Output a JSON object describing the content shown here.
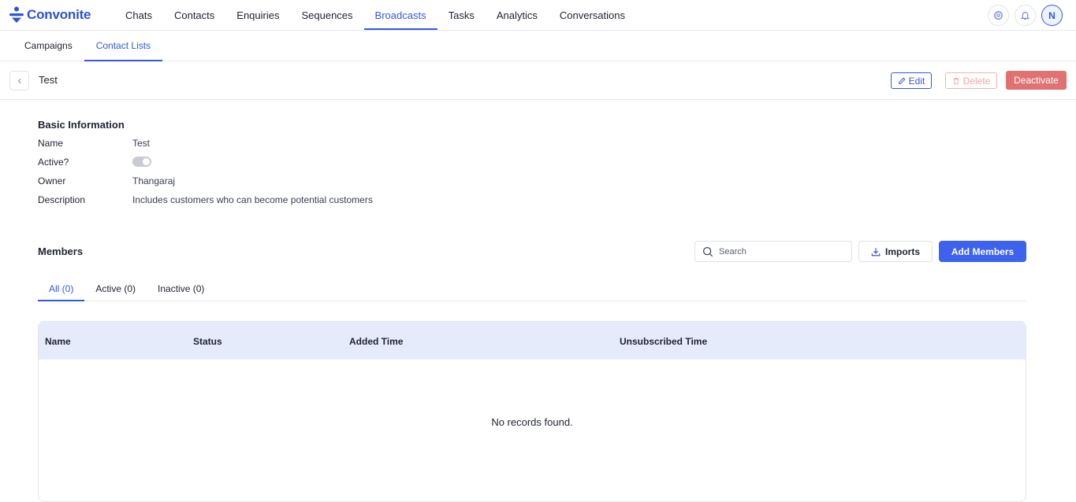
{
  "brand": {
    "name": "Convonite",
    "color": "#2c52d6"
  },
  "nav": {
    "items": [
      {
        "label": "Chats"
      },
      {
        "label": "Contacts"
      },
      {
        "label": "Enquiries"
      },
      {
        "label": "Sequences"
      },
      {
        "label": "Broadcasts",
        "active": true
      },
      {
        "label": "Tasks"
      },
      {
        "label": "Analytics"
      },
      {
        "label": "Conversations"
      }
    ],
    "icons": [
      "gear-icon",
      "bell-icon"
    ],
    "avatar_initial": "N"
  },
  "subtabs": [
    {
      "label": "Campaigns"
    },
    {
      "label": "Contact Lists",
      "active": true
    }
  ],
  "header": {
    "title": "Test",
    "edit_label": "Edit",
    "delete_label": "Delete",
    "deactivate_label": "Deactivate"
  },
  "basic_info": {
    "title": "Basic Information",
    "name_label": "Name",
    "name_value": "Test",
    "active_label": "Active?",
    "active_value": false,
    "owner_label": "Owner",
    "owner_value": "Thangaraj",
    "description_label": "Description",
    "description_value": "Includes customers who can become potential customers"
  },
  "members": {
    "title": "Members",
    "search_placeholder": "Search",
    "imports_label": "Imports",
    "add_label": "Add Members",
    "tabs": [
      {
        "label": "All (0)",
        "active": true
      },
      {
        "label": "Active (0)"
      },
      {
        "label": "Inactive (0)"
      }
    ],
    "columns": [
      "Name",
      "Status",
      "Added Time",
      "Unsubscribed Time"
    ],
    "empty_text": "No records found."
  },
  "colors": {
    "accent": "#3557e0",
    "primary_button": "#3d63ee",
    "danger_button": "#e07272",
    "table_header": "#e6ebfc"
  }
}
